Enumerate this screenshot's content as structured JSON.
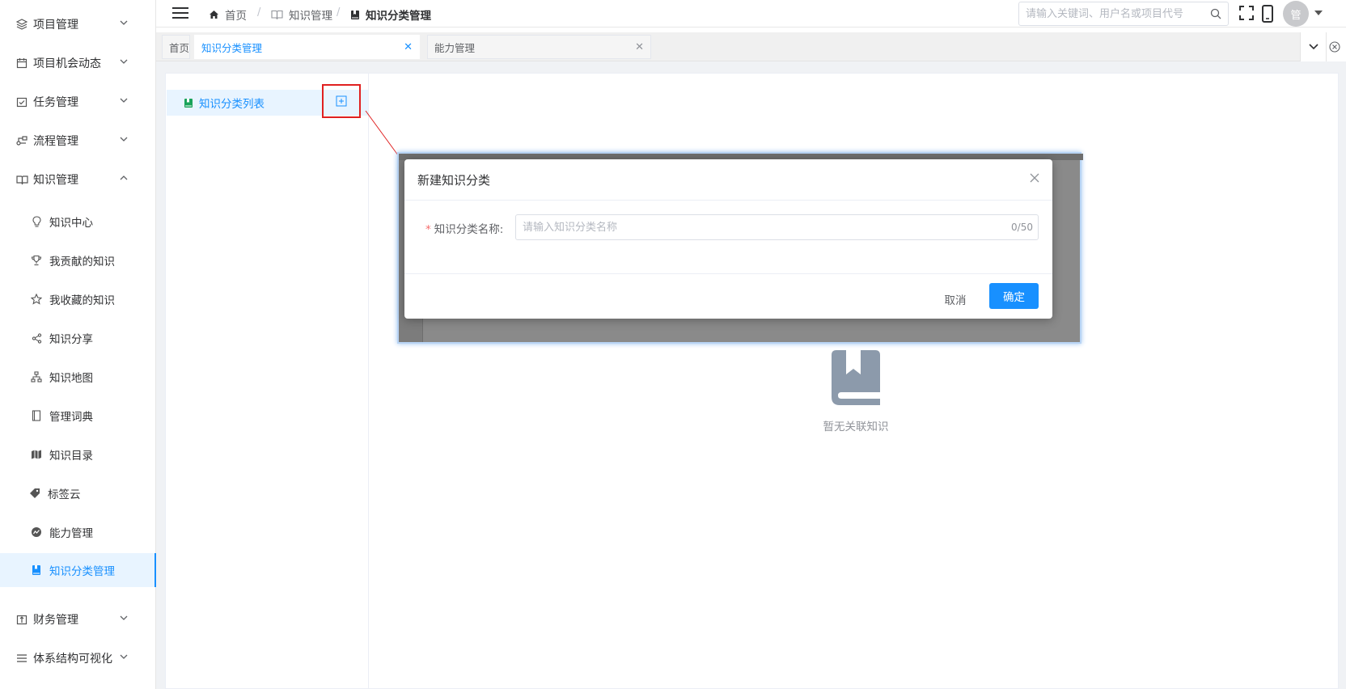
{
  "sidebar": {
    "items": [
      {
        "label": "项目管理",
        "icon": "layers-icon",
        "expanded": false
      },
      {
        "label": "项目机会动态",
        "icon": "calendar-icon",
        "expanded": false
      },
      {
        "label": "任务管理",
        "icon": "task-check-icon",
        "expanded": false
      },
      {
        "label": "流程管理",
        "icon": "flow-icon",
        "expanded": false
      },
      {
        "label": "知识管理",
        "icon": "book-open-icon",
        "expanded": true
      },
      {
        "label": "财务管理",
        "icon": "finance-icon",
        "expanded": false
      },
      {
        "label": "体系结构可视化",
        "icon": "list-icon",
        "expanded": false
      }
    ],
    "sub_items": [
      {
        "label": "知识中心",
        "icon": "bulb-icon"
      },
      {
        "label": "我贡献的知识",
        "icon": "trophy-icon"
      },
      {
        "label": "我收藏的知识",
        "icon": "star-icon"
      },
      {
        "label": "知识分享",
        "icon": "share-icon"
      },
      {
        "label": "知识地图",
        "icon": "org-chart-icon"
      },
      {
        "label": "管理词典",
        "icon": "dictionary-icon"
      },
      {
        "label": "知识目录",
        "icon": "map-icon"
      },
      {
        "label": "标签云",
        "icon": "tag-icon"
      },
      {
        "label": "能力管理",
        "icon": "chart-circle-icon"
      },
      {
        "label": "知识分类管理",
        "icon": "bookmark-book-icon",
        "active": true
      }
    ]
  },
  "header": {
    "breadcrumb": [
      "首页",
      "知识管理",
      "知识分类管理"
    ],
    "search_placeholder": "请输入关键词、用户名或项目代号",
    "avatar_text": "管"
  },
  "tabs": [
    {
      "label": "首页",
      "closable": false,
      "active": false
    },
    {
      "label": "知识分类管理",
      "closable": true,
      "active": true
    },
    {
      "label": "能力管理",
      "closable": true,
      "active": false
    }
  ],
  "tree": {
    "root_label": "知识分类列表"
  },
  "empty_state": {
    "text": "暂无关联知识"
  },
  "dialog": {
    "title": "新建知识分类",
    "field_label": "知识分类名称:",
    "field_required_mark": "*",
    "field_placeholder": "请输入知识分类名称",
    "field_value": "",
    "char_count": "0/50",
    "cancel_label": "取消",
    "confirm_label": "确定"
  },
  "colors": {
    "primary": "#1890ff",
    "annotation": "#e02020",
    "required": "#f56c6c"
  }
}
